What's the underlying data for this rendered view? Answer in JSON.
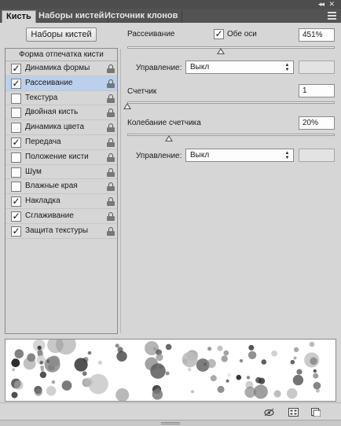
{
  "tabs": [
    {
      "label": "Кисть",
      "active": true
    },
    {
      "label": "Наборы кистей",
      "active": false
    },
    {
      "label": "Источник клонов",
      "active": false
    }
  ],
  "window_controls": {
    "collapse": "◂◂",
    "close": "✕"
  },
  "presets_button": "Наборы кистей",
  "left_panel": {
    "header": "Форма отпечатка кисти",
    "items": [
      {
        "label": "Динамика формы",
        "checked": true,
        "selected": false
      },
      {
        "label": "Рассеивание",
        "checked": true,
        "selected": true
      },
      {
        "label": "Текстура",
        "checked": false,
        "selected": false
      },
      {
        "label": "Двойная кисть",
        "checked": false,
        "selected": false
      },
      {
        "label": "Динамика цвета",
        "checked": false,
        "selected": false
      },
      {
        "label": "Передача",
        "checked": true,
        "selected": false
      },
      {
        "label": "Положение кисти",
        "checked": false,
        "selected": false
      },
      {
        "label": "Шум",
        "checked": false,
        "selected": false
      },
      {
        "label": "Влажные края",
        "checked": false,
        "selected": false
      },
      {
        "label": "Накладка",
        "checked": true,
        "selected": false
      },
      {
        "label": "Сглаживание",
        "checked": true,
        "selected": false
      },
      {
        "label": "Защита текстуры",
        "checked": true,
        "selected": false
      }
    ]
  },
  "scatter": {
    "label": "Рассеивание",
    "both_axes_label": "Обе оси",
    "both_axes_checked": true,
    "value": "451%",
    "slider_level_fraction": 0.45,
    "control_label": "Управление:",
    "control_value": "Выкл"
  },
  "count": {
    "label": "Счетчик",
    "value": "1",
    "slider_level_fraction": 0.0
  },
  "count_jitter": {
    "label": "Колебание счетчика",
    "value": "20%",
    "slider_level_fraction": 0.2,
    "control_label": "Управление:",
    "control_value": "Выкл"
  },
  "check_glyph": "✓",
  "colors": {
    "panel_bg": "#d6d6d6",
    "tabbar_bg": "#535353",
    "selected_row": "#bcd0ec"
  },
  "bottom_icons": [
    "eye-toggle-icon",
    "grid-icon",
    "new-brush-icon"
  ]
}
